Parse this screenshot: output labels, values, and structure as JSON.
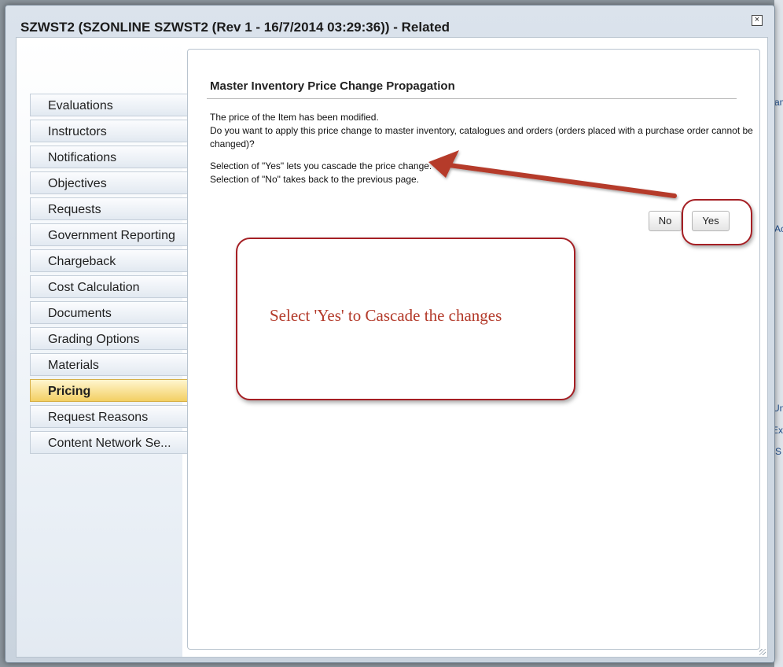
{
  "dialog": {
    "title": "SZWST2 (SZONLINE SZWST2 (Rev 1 - 16/7/2014 03:29:36)) - Related",
    "close_symbol": "×"
  },
  "sidebar": {
    "items": [
      {
        "label": "Evaluations",
        "active": false
      },
      {
        "label": "Instructors",
        "active": false
      },
      {
        "label": "Notifications",
        "active": false
      },
      {
        "label": "Objectives",
        "active": false
      },
      {
        "label": "Requests",
        "active": false
      },
      {
        "label": "Government Reporting",
        "active": false
      },
      {
        "label": "Chargeback",
        "active": false
      },
      {
        "label": "Cost Calculation",
        "active": false
      },
      {
        "label": "Documents",
        "active": false
      },
      {
        "label": "Grading Options",
        "active": false
      },
      {
        "label": "Materials",
        "active": false
      },
      {
        "label": "Pricing",
        "active": true
      },
      {
        "label": "Request Reasons",
        "active": false
      },
      {
        "label": "Content Network Se...",
        "active": false
      }
    ]
  },
  "content": {
    "title": "Master Inventory Price Change Propagation",
    "line1": "The price of the Item has been modified.",
    "line2": "Do you want to apply this price change to master inventory, catalogues and orders (orders placed with a purchase order cannot be",
    "line3": "changed)?",
    "line4": "Selection of \"Yes\" lets you cascade the price change.",
    "line5": "Selection of \"No\" takes back to the previous page.",
    "no_label": "No",
    "yes_label": "Yes"
  },
  "annotation": {
    "callout_text": "Select 'Yes' to Cascade the changes",
    "accent_color": "#a51f24"
  },
  "background_fragments": [
    "Un",
    "Exp",
    "S",
    "Ac",
    "am"
  ]
}
